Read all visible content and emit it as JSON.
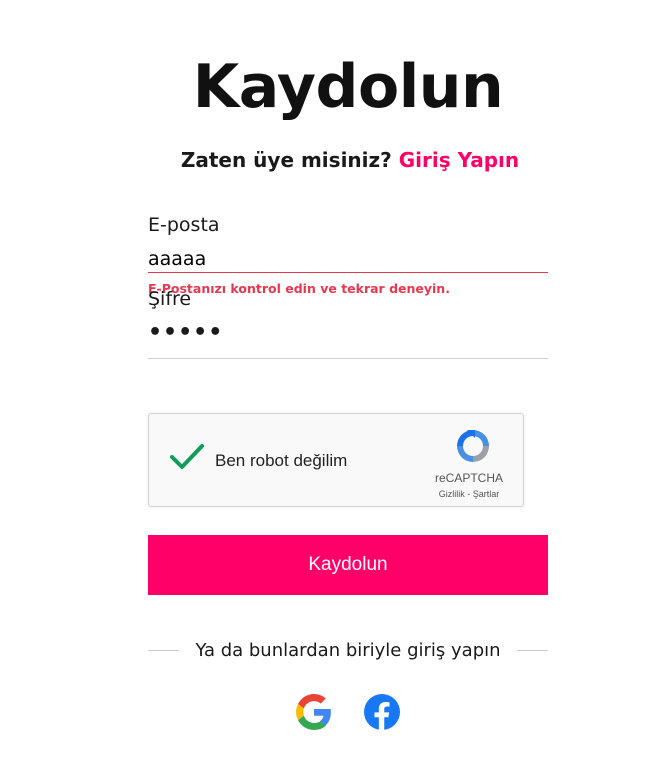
{
  "page": {
    "title": "Kaydolun"
  },
  "login_prompt": {
    "text": "Zaten üye misiniz?",
    "link": "Giriş Yapın"
  },
  "form": {
    "email": {
      "label": "E-posta",
      "value": "aaaaa",
      "error": "E-Postanızı kontrol edin ve tekrar deneyin."
    },
    "password": {
      "label": "Şifre",
      "value": "•••••"
    }
  },
  "captcha": {
    "label": "Ben robot değilim",
    "checked": true,
    "brand": "reCAPTCHA",
    "terms": "Gizlilik - Şartlar"
  },
  "submit": {
    "label": "Kaydolun"
  },
  "social": {
    "divider_text": "Ya da bunlardan biriyle giriş yapın",
    "providers": [
      "google-icon",
      "facebook-icon"
    ]
  },
  "colors": {
    "accent": "#ff0068",
    "error": "#e8384f",
    "facebook": "#1877f2"
  }
}
